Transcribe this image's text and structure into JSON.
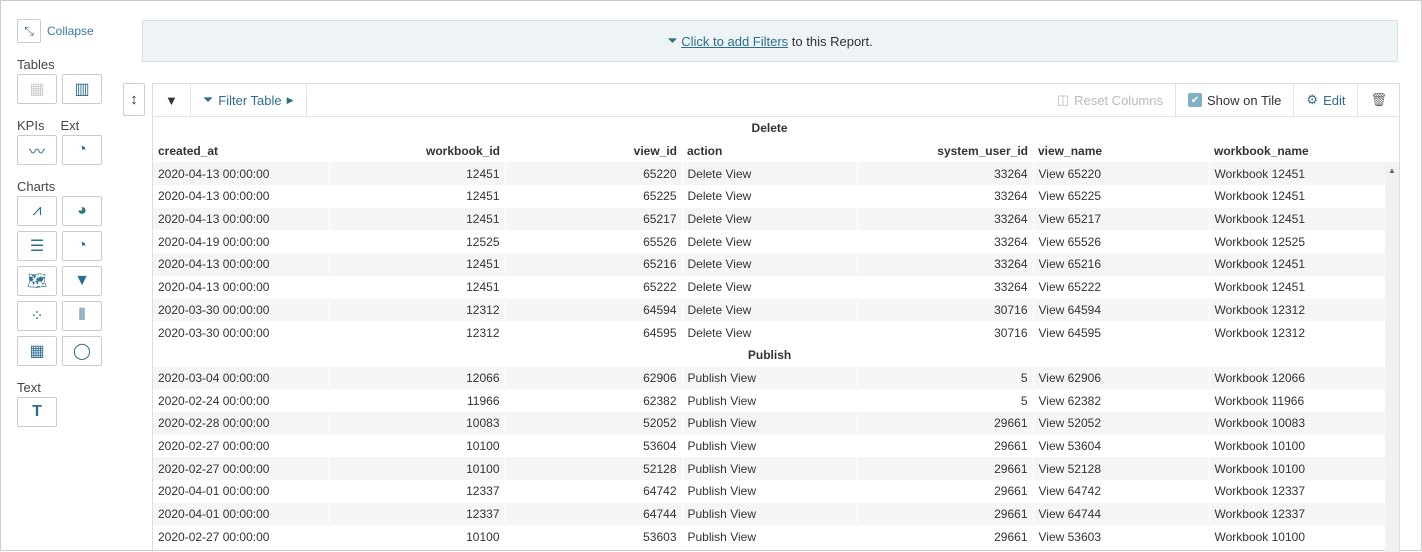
{
  "sidebar": {
    "collapse": "Collapse",
    "sections": {
      "tables": "Tables",
      "kpis": "KPIs",
      "ext": "Ext",
      "charts": "Charts",
      "text": "Text"
    }
  },
  "filter_bar": {
    "link": "Click to add Filters",
    "rest": " to this Report."
  },
  "toolbar": {
    "filter_table": "Filter Table",
    "reset_columns": "Reset Columns",
    "show_on_tile": "Show on Tile",
    "show_on_tile_checked": true,
    "edit": "Edit"
  },
  "table": {
    "columns": [
      "created_at",
      "workbook_id",
      "view_id",
      "action",
      "system_user_id",
      "view_name",
      "workbook_name"
    ],
    "groups": [
      {
        "name": "Delete",
        "rows": [
          [
            "2020-04-13 00:00:00",
            "12451",
            "65220",
            "Delete View",
            "33264",
            "View 65220",
            "Workbook 12451"
          ],
          [
            "2020-04-13 00:00:00",
            "12451",
            "65225",
            "Delete View",
            "33264",
            "View 65225",
            "Workbook 12451"
          ],
          [
            "2020-04-13 00:00:00",
            "12451",
            "65217",
            "Delete View",
            "33264",
            "View 65217",
            "Workbook 12451"
          ],
          [
            "2020-04-19 00:00:00",
            "12525",
            "65526",
            "Delete View",
            "33264",
            "View 65526",
            "Workbook 12525"
          ],
          [
            "2020-04-13 00:00:00",
            "12451",
            "65216",
            "Delete View",
            "33264",
            "View 65216",
            "Workbook 12451"
          ],
          [
            "2020-04-13 00:00:00",
            "12451",
            "65222",
            "Delete View",
            "33264",
            "View 65222",
            "Workbook 12451"
          ],
          [
            "2020-03-30 00:00:00",
            "12312",
            "64594",
            "Delete View",
            "30716",
            "View 64594",
            "Workbook 12312"
          ],
          [
            "2020-03-30 00:00:00",
            "12312",
            "64595",
            "Delete View",
            "30716",
            "View 64595",
            "Workbook 12312"
          ]
        ]
      },
      {
        "name": "Publish",
        "rows": [
          [
            "2020-03-04 00:00:00",
            "12066",
            "62906",
            "Publish View",
            "5",
            "View 62906",
            "Workbook 12066"
          ],
          [
            "2020-02-24 00:00:00",
            "11966",
            "62382",
            "Publish View",
            "5",
            "View 62382",
            "Workbook 11966"
          ],
          [
            "2020-02-28 00:00:00",
            "10083",
            "52052",
            "Publish View",
            "29661",
            "View 52052",
            "Workbook 10083"
          ],
          [
            "2020-02-27 00:00:00",
            "10100",
            "53604",
            "Publish View",
            "29661",
            "View 53604",
            "Workbook 10100"
          ],
          [
            "2020-02-27 00:00:00",
            "10100",
            "52128",
            "Publish View",
            "29661",
            "View 52128",
            "Workbook 10100"
          ],
          [
            "2020-04-01 00:00:00",
            "12337",
            "64742",
            "Publish View",
            "29661",
            "View 64742",
            "Workbook 12337"
          ],
          [
            "2020-04-01 00:00:00",
            "12337",
            "64744",
            "Publish View",
            "29661",
            "View 64744",
            "Workbook 12337"
          ],
          [
            "2020-02-27 00:00:00",
            "10100",
            "53603",
            "Publish View",
            "29661",
            "View 53603",
            "Workbook 10100"
          ]
        ]
      }
    ]
  }
}
